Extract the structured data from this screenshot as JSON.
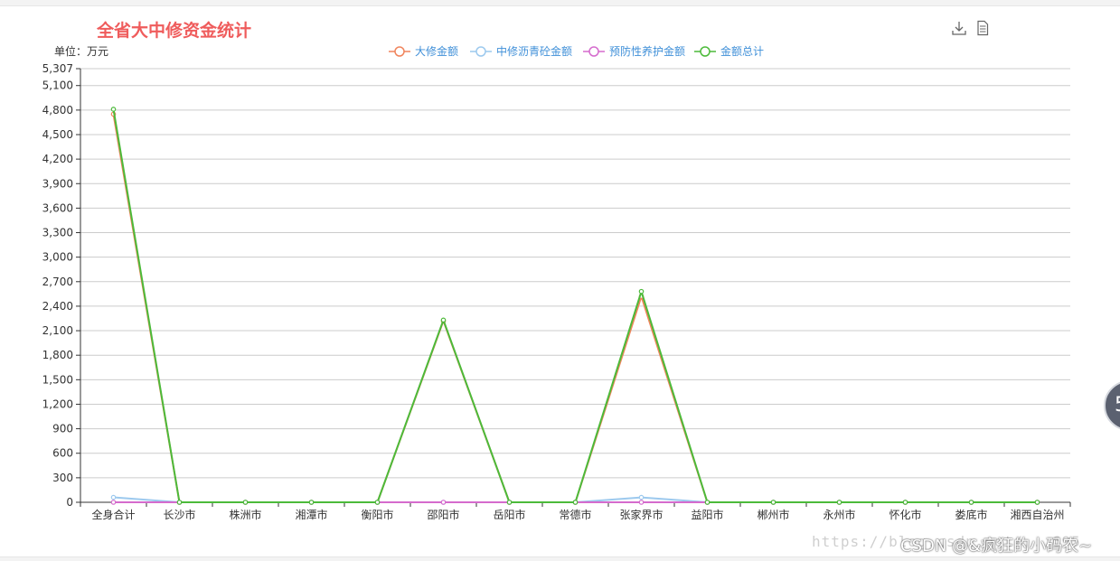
{
  "chart_data": {
    "type": "line",
    "title": "全省大中修资金统计",
    "unit_label": "单位：万元",
    "categories": [
      "全身合计",
      "长沙市",
      "株洲市",
      "湘潭市",
      "衡阳市",
      "邵阳市",
      "岳阳市",
      "常德市",
      "张家界市",
      "益阳市",
      "郴州市",
      "永州市",
      "怀化市",
      "娄底市",
      "湘西自治州"
    ],
    "series": [
      {
        "name": "大修金额",
        "color": "#f0845c",
        "values": [
          4750,
          0,
          0,
          0,
          0,
          2220,
          0,
          0,
          2520,
          0,
          0,
          0,
          0,
          0,
          0
        ]
      },
      {
        "name": "中修沥青砼金额",
        "color": "#9cc9ee",
        "values": [
          60,
          0,
          0,
          0,
          0,
          0,
          0,
          0,
          60,
          0,
          0,
          0,
          0,
          0,
          0
        ]
      },
      {
        "name": "预防性养护金额",
        "color": "#d56bcd",
        "values": [
          0,
          0,
          0,
          0,
          0,
          0,
          0,
          0,
          0,
          0,
          0,
          0,
          0,
          0,
          0
        ]
      },
      {
        "name": "金额总计",
        "color": "#4cba3a",
        "values": [
          4810,
          0,
          0,
          0,
          0,
          2230,
          0,
          0,
          2580,
          0,
          0,
          0,
          0,
          0,
          0
        ]
      }
    ],
    "yticks": [
      "0",
      "300",
      "600",
      "900",
      "1,200",
      "1,500",
      "1,800",
      "2,100",
      "2,400",
      "2,700",
      "3,000",
      "3,300",
      "3,600",
      "3,900",
      "4,200",
      "4,500",
      "4,800",
      "5,100",
      "5,307"
    ],
    "ylim": [
      0,
      5307
    ],
    "grid": true,
    "legend_position": "top-center"
  },
  "toolbox": {
    "download_icon": "download-icon",
    "dataview_icon": "document-icon"
  },
  "overlay": {
    "badge_text": "5",
    "watermark_url": "https://blog.csdn.net/...695",
    "watermark_csdn": "CSDN @&疯狂的小码农~"
  }
}
